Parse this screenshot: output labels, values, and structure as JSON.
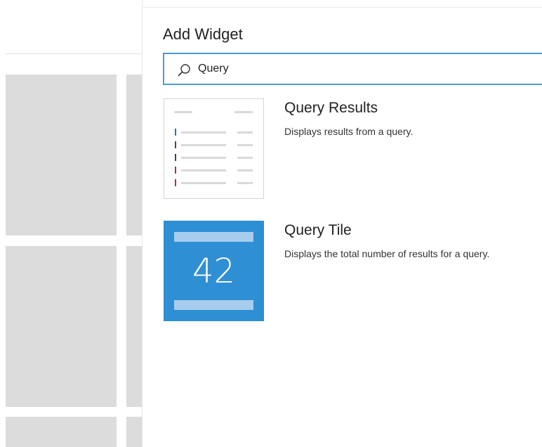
{
  "panel": {
    "title": "Add Widget",
    "search": {
      "value": "Query",
      "placeholder": "Search"
    }
  },
  "widgets": [
    {
      "name": "Query Results",
      "description": "Displays results from a query."
    },
    {
      "name": "Query Tile",
      "description": "Displays the total number of results for a query.",
      "tile_value": "42"
    }
  ],
  "colors": {
    "accent": "#4a9ad8",
    "tile_background": "#2f8fd4",
    "dashboard_tile": "#dcdcdc",
    "result_marks": [
      "#2a74b8",
      "#7a2a78",
      "#5a2a80",
      "#b03030",
      "#b03030"
    ]
  }
}
